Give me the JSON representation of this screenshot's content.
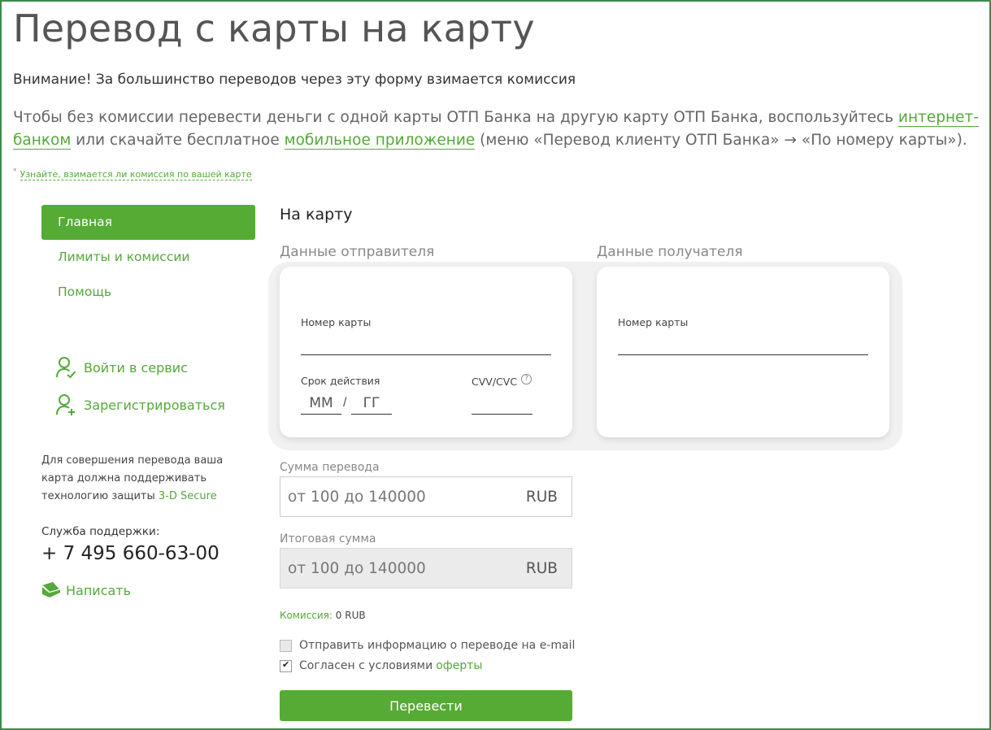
{
  "page": {
    "title": "Перевод с карты на карту",
    "warning": "Внимание! За большинство переводов через эту форму взимается комиссия",
    "intro": {
      "part1": "Чтобы без комиссии перевести деньги с одной карты ОТП Банка на другую карту ОТП Банка, воспользуйтесь ",
      "link1": "интернет-банком",
      "part2": " или скачайте бесплатное ",
      "link2": "мобильное приложение",
      "part3": " (меню «Перевод клиенту ОТП Банка» → «По номеру карты»)."
    },
    "note_star": "*",
    "note_link": "Узнайте, взимается ли комиссия по вашей карте"
  },
  "sidebar": {
    "nav": [
      {
        "label": "Главная",
        "active": true
      },
      {
        "label": "Лимиты и комиссии",
        "active": false
      },
      {
        "label": "Помощь",
        "active": false
      }
    ],
    "login": "Войти в сервис",
    "register": "Зарегистрироваться",
    "secure_text": "Для совершения перевода ваша карта должна поддерживать технологию защиты ",
    "secure_link": "3-D Secure",
    "support_label": "Служба поддержки:",
    "support_phone": "+ 7 495 660-63-00",
    "write": "Написать"
  },
  "form": {
    "title": "На карту",
    "sender_label": "Данные отправителя",
    "receiver_label": "Данные получателя",
    "sender": {
      "card_number_label": "Номер карты",
      "expiry_label": "Срок действия",
      "month_placeholder": "ММ",
      "year_placeholder": "ГГ",
      "expiry_separator": "/",
      "cvv_label": "CVV/CVC",
      "help": "?"
    },
    "receiver": {
      "card_number_label": "Номер карты"
    },
    "amount_label": "Сумма перевода",
    "amount_placeholder": "от 100 до 140000",
    "amount_currency": "RUB",
    "total_label": "Итоговая сумма",
    "total_placeholder": "от 100 до 140000",
    "total_currency": "RUB",
    "commission_label": "Комиссия:",
    "commission_value": " 0 RUB",
    "email_checkbox": "Отправить информацию о переводе на e-mail",
    "agree_text": "Согласен с условиями ",
    "agree_link": "оферты",
    "submit": "Перевести"
  },
  "colors": {
    "accent": "#55ab34",
    "link": "#55a83a",
    "frame": "#3d8a4a"
  }
}
